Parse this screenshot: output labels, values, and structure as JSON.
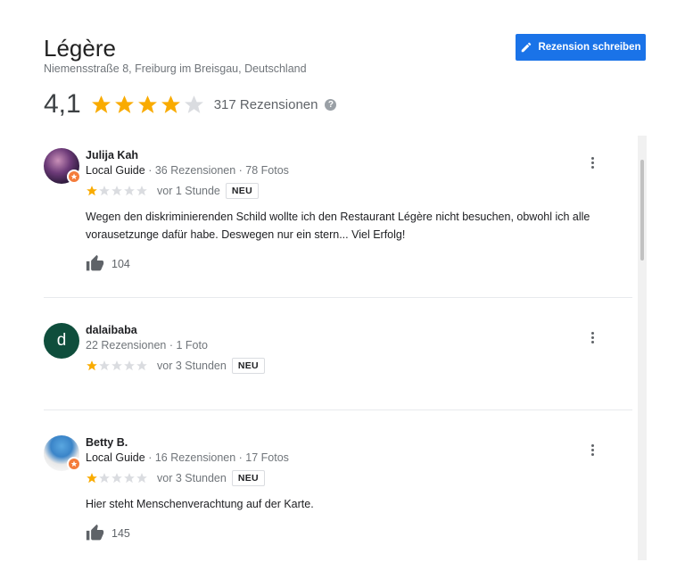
{
  "place": {
    "name": "Légère",
    "address": "Niemensstraße 8, Freiburg im Breisgau, Deutschland",
    "write_review_label": "Rezension schreiben",
    "average_rating_text": "4,1",
    "average_rating": 4.1,
    "review_count_text": "317 Rezensionen"
  },
  "colors": {
    "accent": "#1a73e8",
    "star_filled": "#f9ab00",
    "star_empty": "#dadce0",
    "guide_badge": "#f47c3c",
    "avatar_letter_bg": "#0f4e3c"
  },
  "reviews": [
    {
      "author": "Julija Kah",
      "guide": "Local Guide",
      "stats": " · 36 Rezensionen · 78 Fotos",
      "rating": 1,
      "time": "vor 1 Stunde",
      "new_label": "NEU",
      "text": "Wegen den diskriminierenden Schild wollte ich den Restaurant Légère nicht besuchen, obwohl ich alle vorausetzunge dafür habe. Deswegen nur ein stern...  Viel Erfolg!",
      "likes": "104",
      "avatar": "photo"
    },
    {
      "author": "dalaibaba",
      "stats": "22 Rezensionen · 1 Foto",
      "rating": 1,
      "time": "vor 3 Stunden",
      "new_label": "NEU",
      "avatar_letter": "d"
    },
    {
      "author": "Betty B.",
      "guide": "Local Guide",
      "stats": " · 16 Rezensionen · 17 Fotos",
      "rating": 1,
      "time": "vor 3 Stunden",
      "new_label": "NEU",
      "text": "Hier steht Menschenverachtung auf der Karte.",
      "likes": "145",
      "avatar": "smurf-photo"
    }
  ]
}
